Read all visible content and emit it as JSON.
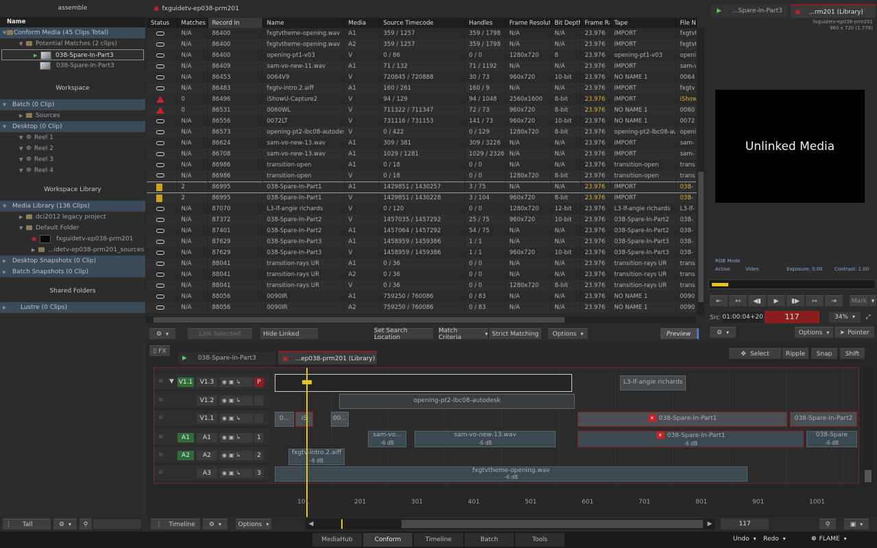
{
  "left_panel": {
    "title": "assemble",
    "header": "Name",
    "items": [
      "Conform Media (45 Clips Total)",
      "Potential Matches (2 clips)",
      "038-Spare-In-Part3",
      "038-Spare-In-Part3"
    ],
    "workspace": "Workspace",
    "ws_items": [
      "Batch (0 Clip)",
      "Sources",
      "Desktop (0 Clip)",
      "Reel 1",
      "Reel 2",
      "Reel 3",
      "Reel 4"
    ],
    "workspace_library": "Workspace Library",
    "lib_items": [
      "Media Library (136 Clips)",
      "dci2012 legacy project",
      "Default Folder",
      "fxguidetv-ep038-prm201",
      "...idetv-ep038-prm201_sources",
      "Desktop Snapshots (0 Clip)",
      "Batch Snapshots (0 Clip)"
    ],
    "shared_folders": "Shared Folders",
    "lustre": "Lustre (0 Clips)"
  },
  "browser": {
    "title": "fxguidetv-ep038-prm201",
    "columns": [
      "Status",
      "Matches",
      "Record In",
      "Name",
      "Media",
      "Source Timecode",
      "Handles",
      "Frame Resolutio",
      "Bit Depth",
      "Frame Ra",
      "Tape",
      "File N"
    ],
    "rows": [
      [
        "s",
        "N/A",
        "86400",
        "fxgtvtheme-opening.wav",
        "A1",
        "359 / 1257",
        "359 / 1798",
        "N/A",
        "N/A",
        "23.976",
        "IMPORT",
        "fxgtvt"
      ],
      [
        "s",
        "N/A",
        "86400",
        "fxgtvtheme-opening.wav",
        "A2",
        "359 / 1257",
        "359 / 1798",
        "N/A",
        "N/A",
        "23.976",
        "IMPORT",
        "fxgtvt"
      ],
      [
        "s",
        "N/A",
        "86400",
        "opening-pt1-v03",
        "V",
        "0 / 86",
        "0 / 0",
        "1280x720",
        "8",
        "23.976",
        "opening-pt1-v03",
        "openi"
      ],
      [
        "s",
        "N/A",
        "86409",
        "sam-vo-new-11.wav",
        "A1",
        "71 / 132",
        "71 / 1192",
        "N/A",
        "N/A",
        "23.976",
        "IMPORT",
        "sam-v"
      ],
      [
        "s",
        "N/A",
        "86453",
        "0064V9",
        "V",
        "720845 / 720888",
        "30 / 73",
        "960x720",
        "10-bit",
        "23.976",
        "NO NAME 1",
        "0064"
      ],
      [
        "s",
        "N/A",
        "86483",
        "fxgtv-intro.2.aiff",
        "A1",
        "160 / 261",
        "160 / 9",
        "N/A",
        "N/A",
        "23.976",
        "IMPORT",
        "fxgtv"
      ],
      [
        "w",
        "0",
        "86496",
        "iShowU-Capture2",
        "V",
        "94 / 129",
        "94 / 1048",
        "2560x1600",
        "8-bit",
        "23.976",
        "IMPORT",
        "iShow"
      ],
      [
        "w",
        "0",
        "86531",
        "0060WL",
        "V",
        "711322 / 711347",
        "72 / 73",
        "960x720",
        "8-bit",
        "23.976",
        "NO NAME 1",
        "0060"
      ],
      [
        "s",
        "N/A",
        "86556",
        "0072LT",
        "V",
        "731116 / 731153",
        "141 / 73",
        "960x720",
        "10-bit",
        "23.976",
        "NO NAME 1",
        "0072"
      ],
      [
        "s",
        "N/A",
        "86573",
        "opening-pt2-ibc08-autodes",
        "V",
        "0 / 422",
        "0 / 129",
        "1280x720",
        "8-bit",
        "23.976",
        "opening-pt2-ibc08-au",
        "openi"
      ],
      [
        "s",
        "N/A",
        "86624",
        "sam-vo-new-13.wav",
        "A1",
        "309 / 381",
        "309 / 3226",
        "N/A",
        "N/A",
        "23.976",
        "IMPORT",
        "sam-"
      ],
      [
        "s",
        "N/A",
        "86708",
        "sam-vo-new-13.wav",
        "A1",
        "1029 / 1281",
        "1029 / 2326",
        "N/A",
        "N/A",
        "23.976",
        "IMPORT",
        "sam-"
      ],
      [
        "s",
        "N/A",
        "86986",
        "transition-open",
        "A1",
        "0 / 18",
        "0 / 0",
        "N/A",
        "N/A",
        "23.976",
        "transition-open",
        "trans"
      ],
      [
        "s",
        "N/A",
        "86986",
        "transition-open",
        "V",
        "0 / 18",
        "0 / 0",
        "1280x720",
        "8-bit",
        "23.976",
        "transition-open",
        "trans"
      ],
      [
        "y",
        "2",
        "86995",
        "038-Spare-In-Part1",
        "A1",
        "1429851 / 1430257",
        "3 / 75",
        "N/A",
        "N/A",
        "23.976",
        "IMPORT",
        "038-"
      ],
      [
        "y",
        "2",
        "86995",
        "038-Spare-In-Part1",
        "V",
        "1429851 / 1430228",
        "3 / 104",
        "960x720",
        "8-bit",
        "23.976",
        "IMPORT",
        "038-"
      ],
      [
        "s",
        "N/A",
        "87070",
        "L3-lf-angie richards",
        "V",
        "0 / 120",
        "0 / 0",
        "1280x720",
        "12-bit",
        "23.976",
        "L3-lf-angie richards",
        "L3-lf-"
      ],
      [
        "s",
        "N/A",
        "87372",
        "038-Spare-In-Part2",
        "V",
        "1457035 / 1457292",
        "25 / 75",
        "960x720",
        "10-bit",
        "23.976",
        "038-Spare-In-Part2",
        "038-"
      ],
      [
        "s",
        "N/A",
        "87401",
        "038-Spare-In-Part2",
        "A1",
        "1457064 / 1457292",
        "54 / 75",
        "N/A",
        "N/A",
        "23.976",
        "038-Spare-In-Part2",
        "038-"
      ],
      [
        "s",
        "N/A",
        "87629",
        "038-Spare-In-Part3",
        "A1",
        "1458959 / 1459386",
        "1 / 1",
        "N/A",
        "N/A",
        "23.976",
        "038-Spare-In-Part3",
        "038-"
      ],
      [
        "s",
        "N/A",
        "87629",
        "038-Spare-In-Part3",
        "V",
        "1458959 / 1459386",
        "1 / 1",
        "960x720",
        "10-bit",
        "23.976",
        "038-Spare-In-Part3",
        "038-"
      ],
      [
        "s",
        "N/A",
        "88041",
        "transition-rays UR",
        "A1",
        "0 / 36",
        "0 / 0",
        "N/A",
        "N/A",
        "23.976",
        "transition-rays UR",
        "trans"
      ],
      [
        "s",
        "N/A",
        "88041",
        "transition-rays UR",
        "A2",
        "0 / 36",
        "0 / 0",
        "N/A",
        "N/A",
        "23.976",
        "transition-rays UR",
        "trans"
      ],
      [
        "s",
        "N/A",
        "88041",
        "transition-rays UR",
        "V",
        "0 / 36",
        "0 / 0",
        "1280x720",
        "8-bit",
        "23.976",
        "transition-rays UR",
        "trans"
      ],
      [
        "s",
        "N/A",
        "88056",
        "0090IR",
        "A1",
        "759250 / 760086",
        "0 / 83",
        "N/A",
        "N/A",
        "23.976",
        "NO NAME 1",
        "0090"
      ],
      [
        "s",
        "N/A",
        "88056",
        "0090IR",
        "A2",
        "759250 / 760086",
        "0 / 83",
        "N/A",
        "N/A",
        "23.976",
        "NO NAME 1",
        "0090"
      ]
    ]
  },
  "toolbar": {
    "link_selected": "Link Selected",
    "hide_linked": "Hide Linked",
    "set_search": "Set Search Location",
    "match_criteria": "Match Criteria",
    "strict": "Strict Matching",
    "options": "Options",
    "preview": "Preview"
  },
  "viewer": {
    "tab1": "...Spare-In-Part3",
    "tab2": "...rm201 (Library)",
    "info1": "fxguidetv-ep038-prm201",
    "info2": "960 x 720 (1.778)",
    "unlinked": "Unlinked Media",
    "rgb_mode": "RGB Mode",
    "active": "Active",
    "video": "Video",
    "exposure": "Exposure: 0.00",
    "contrast": "Contrast: 1.00",
    "mark": "Mark",
    "src": "Src",
    "timecode": "01:00:04+20",
    "frame": "117",
    "zoom": "34%",
    "options": "Options",
    "pointer": "Pointer",
    "select": "Select",
    "ripple": "Ripple",
    "snap": "Snap",
    "shift": "Shift"
  },
  "timeline": {
    "fx": "FX",
    "tab1": "038-Spare-In-Part3",
    "tab2": "...ep038-prm201 (Library)",
    "tracks": [
      {
        "a": "V1.1",
        "b": "V1.3",
        "c": "P"
      },
      {
        "a": "",
        "b": "V1.2",
        "c": ""
      },
      {
        "a": "",
        "b": "V1.1",
        "c": ""
      },
      {
        "a": "A1",
        "b": "A1",
        "c": "1"
      },
      {
        "a": "A2",
        "b": "A2",
        "c": "2"
      },
      {
        "a": "",
        "b": "A3",
        "c": "3"
      }
    ],
    "clips": {
      "l3": "L3-lf-angie richards",
      "opening": "opening-pt2-ibc08-autodesk",
      "c0": "0...",
      "is": "iS",
      "c00": "00...",
      "spare1": "038-Spare-In-Part1",
      "spare2": "038-Spare-In-Part2",
      "samvo": "sam-vo...",
      "samvo13": "sam-vo-new-13.wav",
      "spare1a": "038-Spare-In-Part1",
      "spare3a": "038-Spare",
      "intro": "fxgtv-intro.2.aiff",
      "theme": "fxgtvtheme-opening.wav",
      "db": "-6 dB"
    },
    "ruler": [
      "101",
      "201",
      "301",
      "401",
      "501",
      "601",
      "701",
      "801",
      "901",
      "1001"
    ],
    "frame": "117"
  },
  "footer": {
    "tall": "Tall",
    "timeline": "Timeline",
    "options": "Options",
    "undo": "Undo",
    "redo": "Redo",
    "flame": "FLAME"
  },
  "tabs": [
    "MediaHub",
    "Conform",
    "Timeline",
    "Batch",
    "Tools"
  ]
}
